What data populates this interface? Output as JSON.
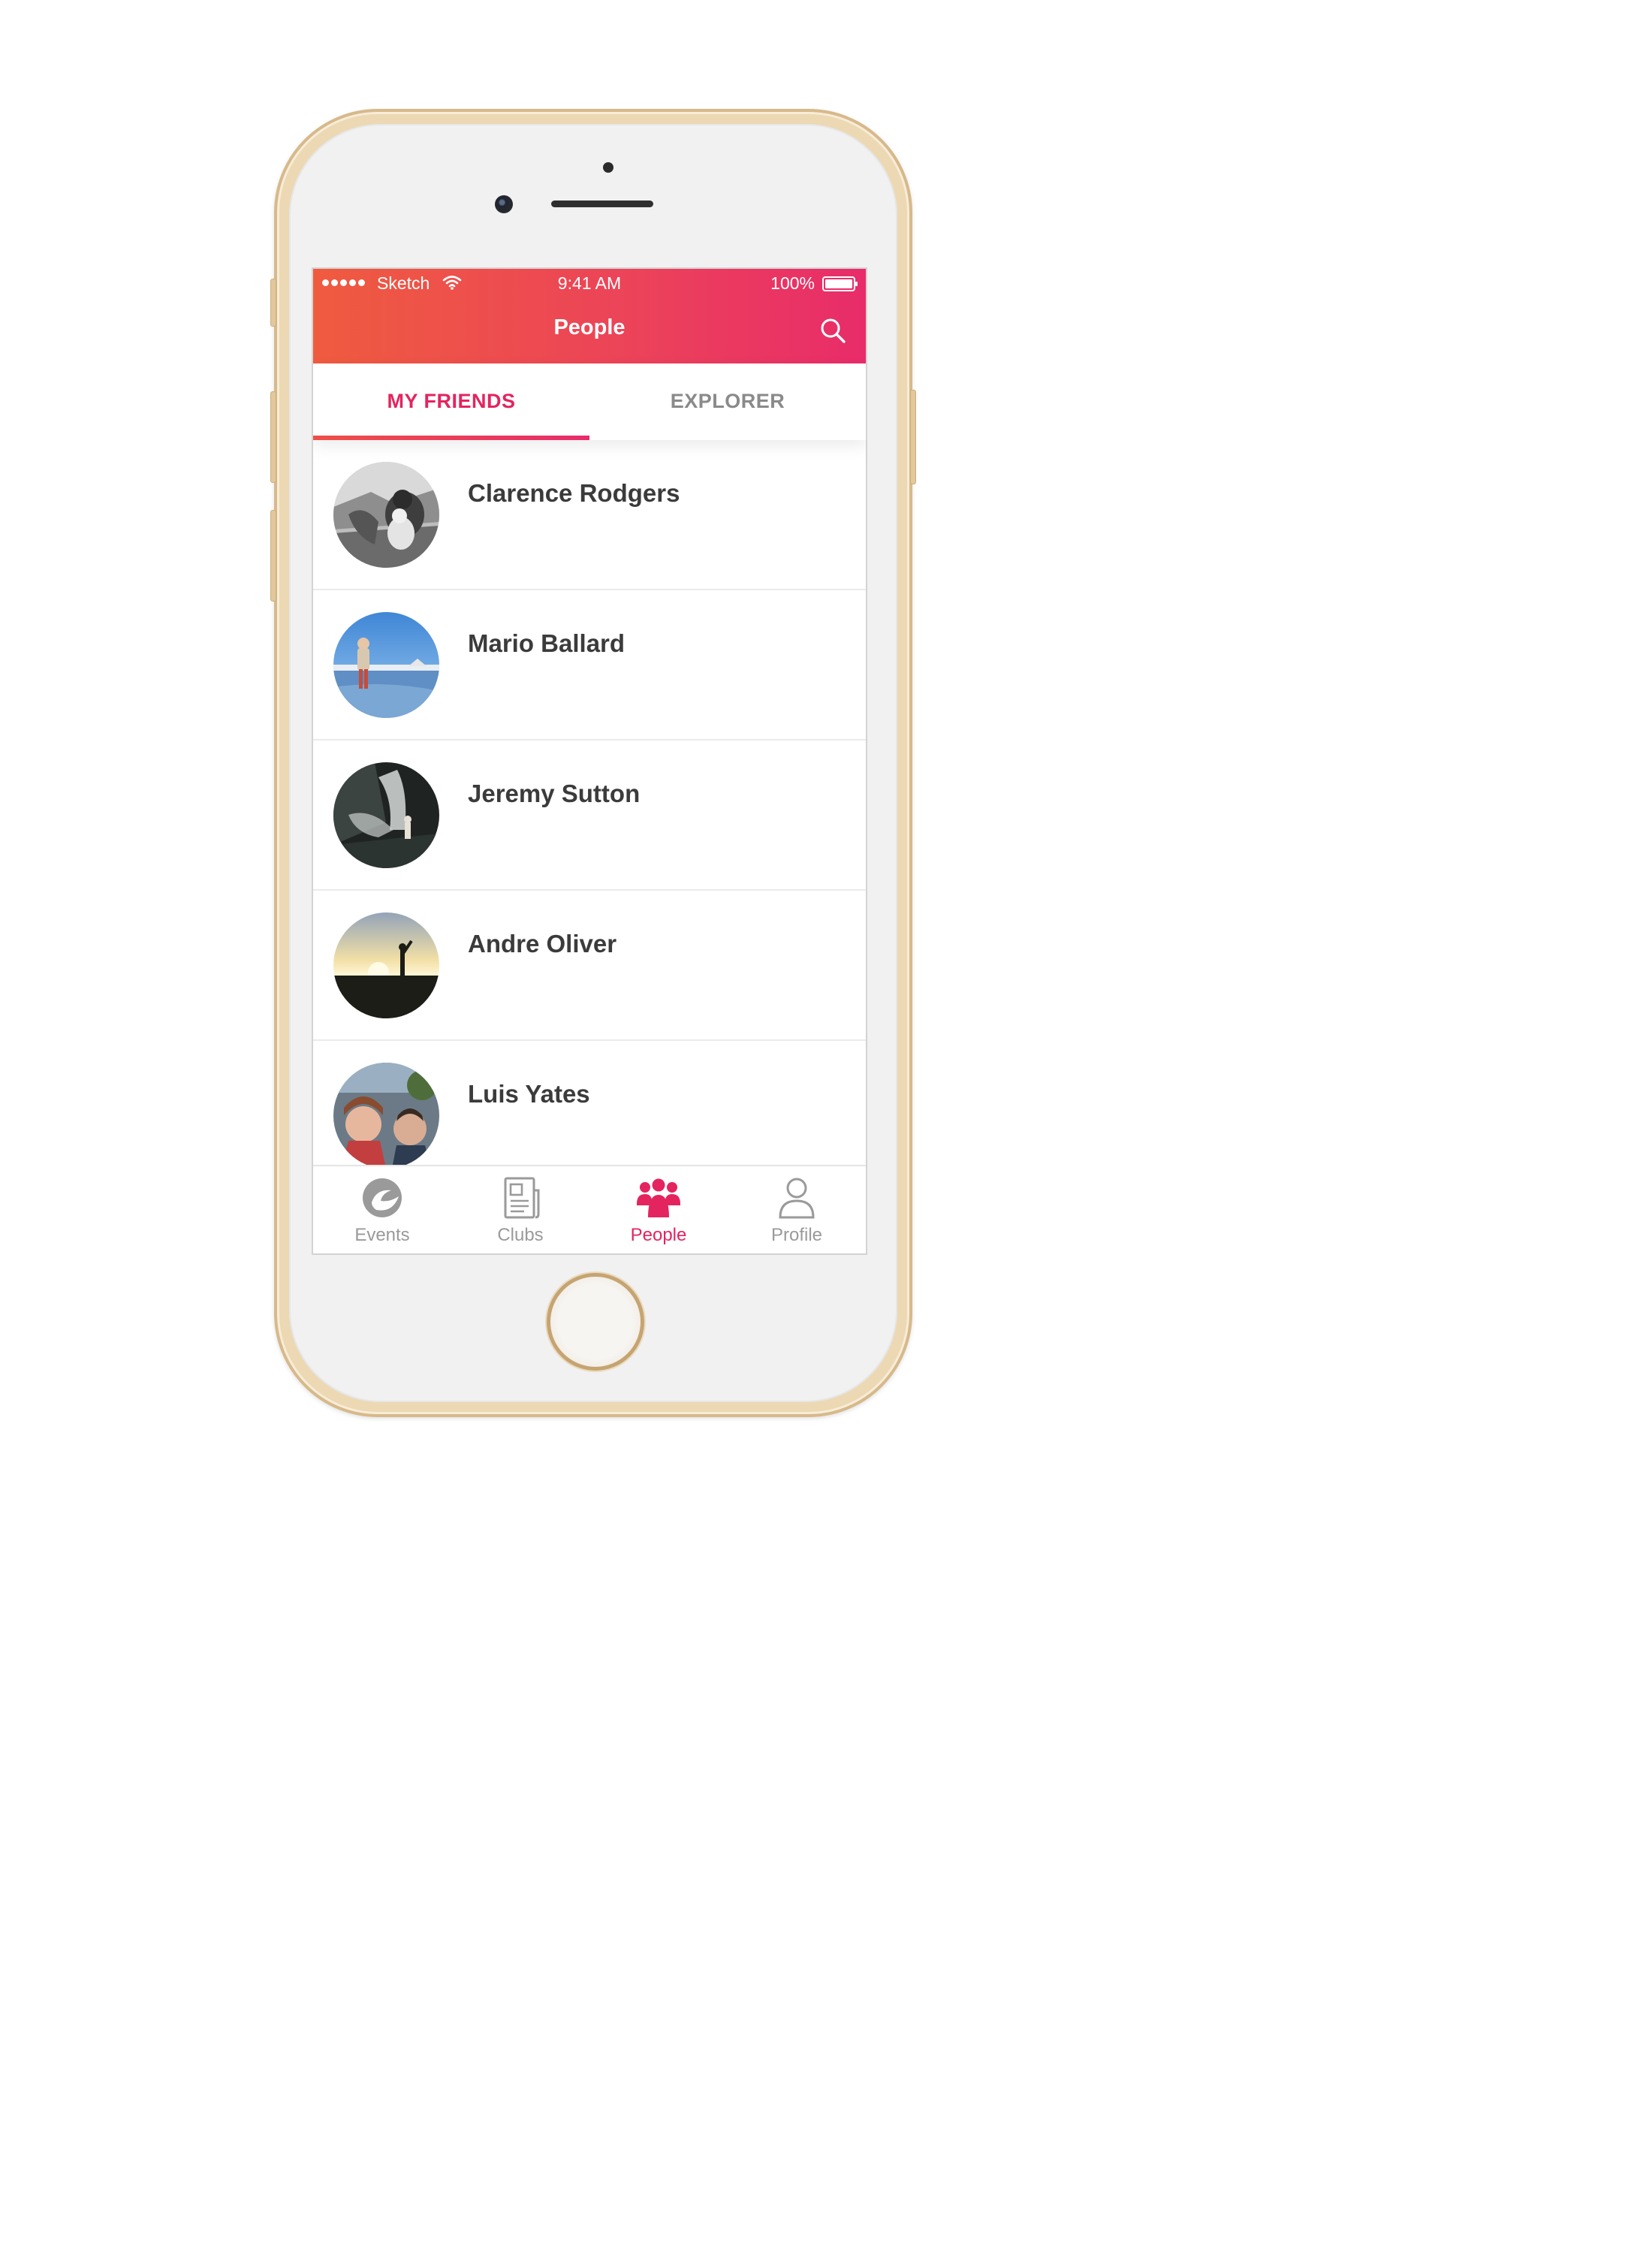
{
  "status_bar": {
    "carrier": "Sketch",
    "time": "9:41 AM",
    "battery": "100%"
  },
  "header": {
    "title": "People",
    "search_icon": "search-icon"
  },
  "tabs": [
    {
      "label": "MY FRIENDS",
      "active": true
    },
    {
      "label": "EXPLORER",
      "active": false
    }
  ],
  "friends": [
    {
      "name": "Clarence Rodgers"
    },
    {
      "name": "Mario Ballard"
    },
    {
      "name": "Jeremy Sutton"
    },
    {
      "name": "Andre Oliver"
    },
    {
      "name": "Luis Yates"
    }
  ],
  "bottom_nav": [
    {
      "label": "Events",
      "icon": "events-icon",
      "active": false
    },
    {
      "label": "Clubs",
      "icon": "clubs-icon",
      "active": false
    },
    {
      "label": "People",
      "icon": "people-icon",
      "active": true
    },
    {
      "label": "Profile",
      "icon": "profile-icon",
      "active": false
    }
  ],
  "colors": {
    "accent": "#e4245f",
    "header_gradient_start": "#ef5b3f",
    "header_gradient_end": "#e82c6a",
    "inactive": "#9a9a9a",
    "phone_gold": "#ecd8b3"
  }
}
